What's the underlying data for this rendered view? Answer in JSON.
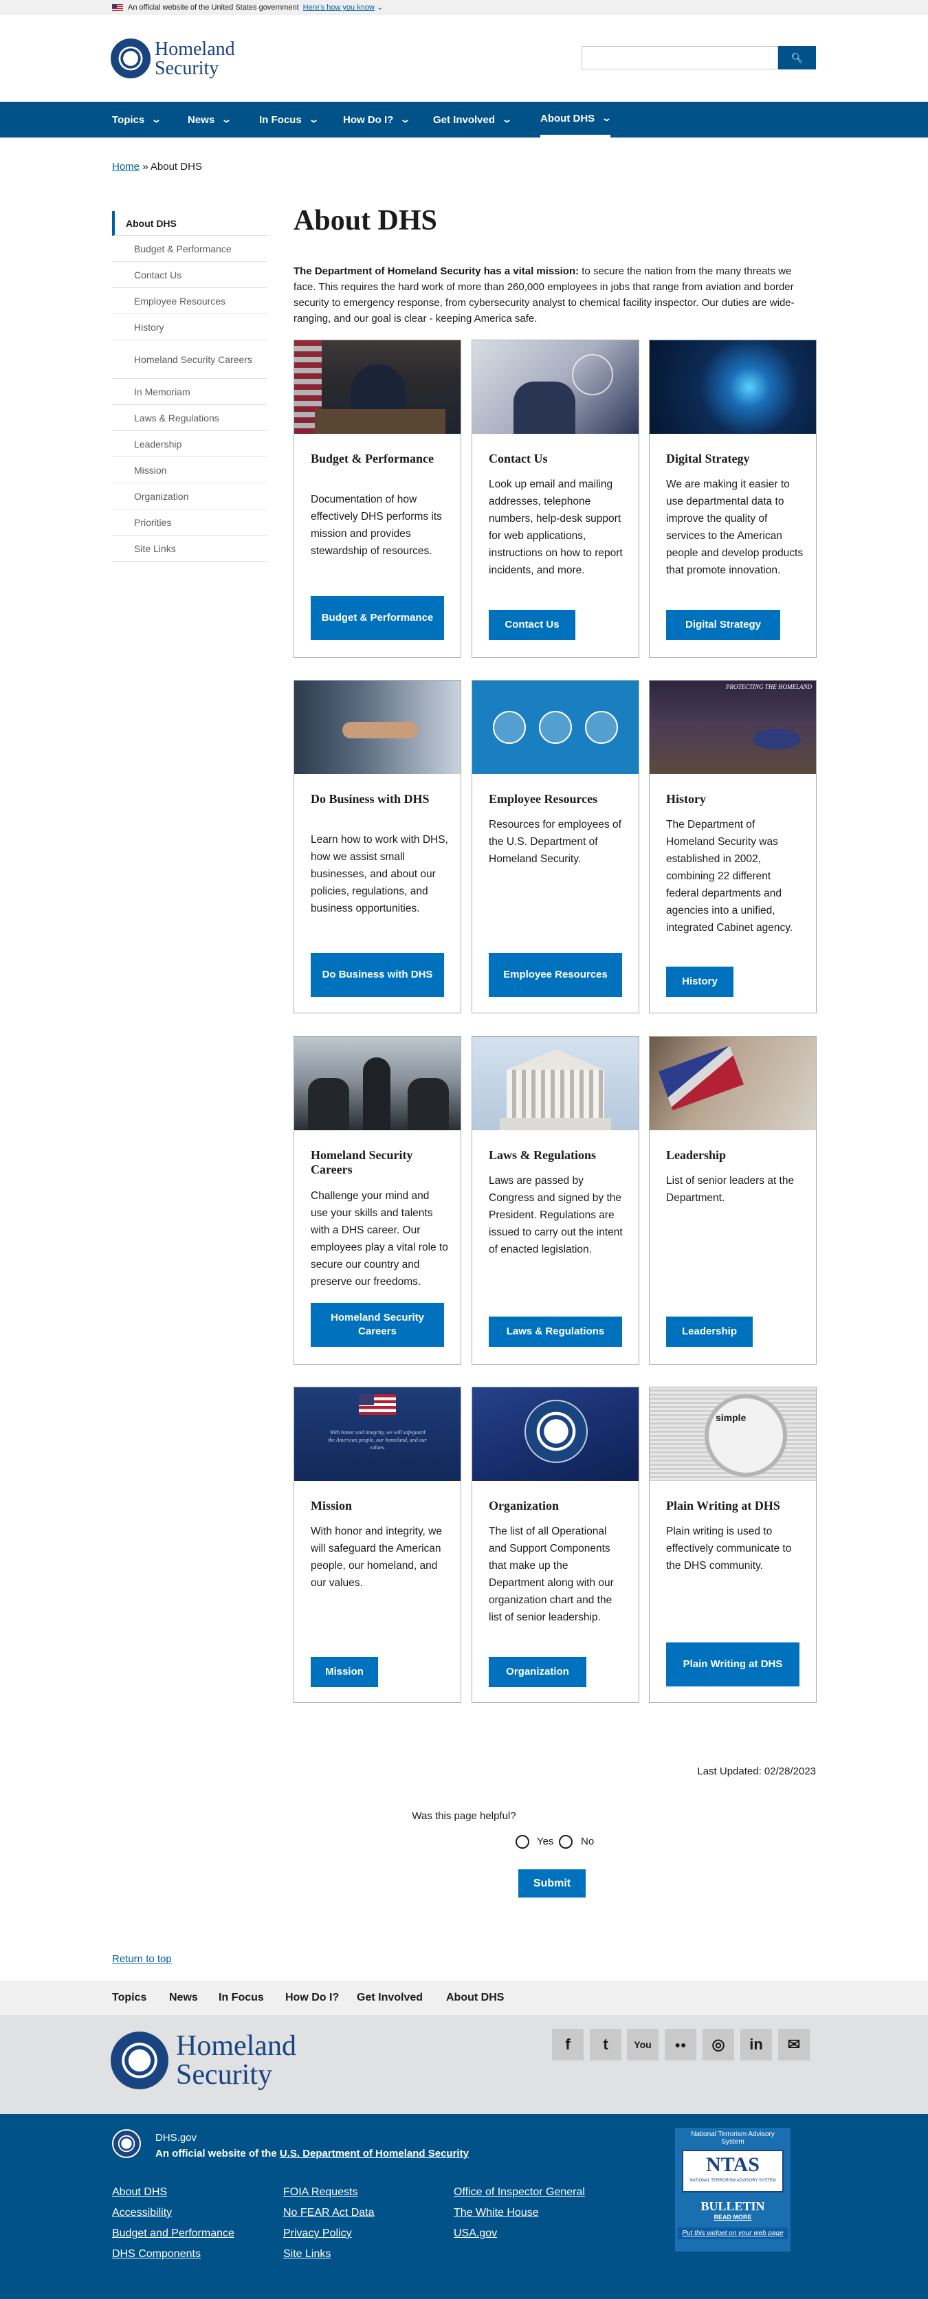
{
  "banner": {
    "text": "An official website of the United States government",
    "link": "Here's how you know"
  },
  "header": {
    "logo_line1": "Homeland",
    "logo_line2": "Security",
    "search_placeholder": "",
    "search_icon": "search-icon"
  },
  "nav": [
    {
      "label": "Topics"
    },
    {
      "label": "News"
    },
    {
      "label": "In Focus"
    },
    {
      "label": "How Do I?"
    },
    {
      "label": "Get Involved"
    },
    {
      "label": "About DHS",
      "active": true
    }
  ],
  "breadcrumb": {
    "home": "Home",
    "sep": "»",
    "current": "About DHS"
  },
  "sidebar": [
    "About DHS",
    "Budget & Performance",
    "Contact Us",
    "Employee Resources",
    "History",
    "Homeland Security Careers",
    "In Memoriam",
    "Laws & Regulations",
    "Leadership",
    "Mission",
    "Organization",
    "Priorities",
    "Site Links"
  ],
  "page": {
    "title": "About DHS",
    "intro_bold": "The Department of Homeland Security has a vital mission:",
    "intro_rest": " to secure the nation from the many threats we face. This requires the hard work of more than 260,000 employees in jobs that range from aviation and border security to emergency response, from cybersecurity analyst to chemical facility inspector. Our duties are wide-ranging, and our goal is clear - keeping America safe."
  },
  "cards": [
    {
      "title": "Budget & Performance",
      "text": "Documentation of how effectively DHS performs its mission and provides stewardship of resources.",
      "button": "Budget & Performance"
    },
    {
      "title": "Contact Us",
      "text": "Look up email and mailing addresses, telephone numbers, help-desk support for web applications, instructions on how to report incidents, and more.",
      "button": "Contact Us"
    },
    {
      "title": "Digital Strategy",
      "text": "We are making it easier to use departmental data to improve the quality of services to the American people and develop products that promote innovation.",
      "button": "Digital Strategy"
    },
    {
      "title": "Do Business with DHS",
      "text": "Learn how to work with DHS, how we assist small businesses, and about our policies, regulations, and business opportunities.",
      "button": "Do Business with DHS"
    },
    {
      "title": "Employee Resources",
      "text": "Resources for employees of the U.S. Department of Homeland Security.",
      "button": "Employee Resources"
    },
    {
      "title": "History",
      "text": "The Department of Homeland Security was established in 2002, combining 22 different federal departments and agencies into a unified, integrated Cabinet agency.",
      "button": "History"
    },
    {
      "title": "Homeland Security Careers",
      "text": "Challenge your mind and use your skills and talents with a DHS career. Our employees play a vital role to secure our country and preserve our freedoms.",
      "button": "Homeland Security Careers"
    },
    {
      "title": "Laws & Regulations",
      "text": "Laws are passed by Congress and signed by the President. Regulations are issued to carry out the intent of enacted legislation.",
      "button": "Laws & Regulations"
    },
    {
      "title": "Leadership",
      "text": "List of senior leaders at the Department.",
      "button": "Leadership"
    },
    {
      "title": "Mission",
      "text": "With honor and integrity, we will safeguard the American people, our homeland, and our values.",
      "button": "Mission"
    },
    {
      "title": "Organization",
      "text": "The list of all Operational and Support Components that make up the Department along with our organization chart and the list of senior leadership.",
      "button": "Organization"
    },
    {
      "title": "Plain Writing at DHS",
      "text": "Plain writing is used to effectively communicate to the DHS community.",
      "button": "Plain Writing at DHS"
    }
  ],
  "card_images": {
    "history_banner": "PROTECTING THE HOMELAND",
    "mission_quote": "With honor and integrity, we will safeguard the American people, our homeland, and our values.",
    "plain_writing_word": "simple"
  },
  "updated": "Last Updated: 02/28/2023",
  "feedback": {
    "question": "Was this page helpful?",
    "yes": "Yes",
    "no": "No",
    "submit": "Submit"
  },
  "return_top": "Return to top",
  "footer_nav": [
    "Topics",
    "News",
    "In Focus",
    "How Do I?",
    "Get Involved",
    "About DHS"
  ],
  "social": [
    {
      "icon": "facebook-icon",
      "glyph": "f"
    },
    {
      "icon": "twitter-icon",
      "glyph": "t"
    },
    {
      "icon": "youtube-icon",
      "glyph": "You"
    },
    {
      "icon": "flickr-icon",
      "glyph": "●●"
    },
    {
      "icon": "instagram-icon",
      "glyph": "◎"
    },
    {
      "icon": "linkedin-icon",
      "glyph": "in"
    },
    {
      "icon": "email-icon",
      "glyph": "✉"
    }
  ],
  "footer": {
    "site": "DHS.gov",
    "official_prefix": "An official website of the ",
    "official_link": "U.S. Department of Homeland Security",
    "links": [
      [
        "About DHS",
        "Accessibility",
        "Budget and Performance",
        "DHS Components"
      ],
      [
        "FOIA Requests",
        "No FEAR Act Data",
        "Privacy Policy",
        "Site Links"
      ],
      [
        "Office of Inspector General",
        "The White House",
        "USA.gov"
      ]
    ]
  },
  "ntas": {
    "top": "National Terrorism Advisory System",
    "logo": "NTAS",
    "sub": "NATIONAL TERRORISM ADVISORY SYSTEM",
    "bulletin": "BULLETIN",
    "read": "READ MORE",
    "widget": "Put this widget on your web page"
  }
}
